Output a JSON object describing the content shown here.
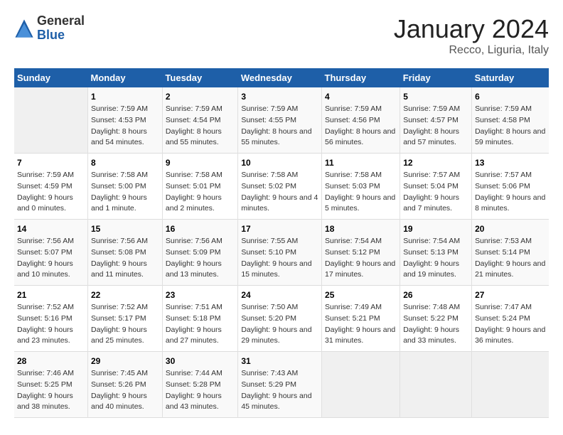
{
  "logo": {
    "general": "General",
    "blue": "Blue"
  },
  "title": "January 2024",
  "subtitle": "Recco, Liguria, Italy",
  "days_header": [
    "Sunday",
    "Monday",
    "Tuesday",
    "Wednesday",
    "Thursday",
    "Friday",
    "Saturday"
  ],
  "weeks": [
    [
      {
        "day": "",
        "sunrise": "",
        "sunset": "",
        "daylight": "",
        "empty": true
      },
      {
        "day": "1",
        "sunrise": "Sunrise: 7:59 AM",
        "sunset": "Sunset: 4:53 PM",
        "daylight": "Daylight: 8 hours and 54 minutes.",
        "empty": false
      },
      {
        "day": "2",
        "sunrise": "Sunrise: 7:59 AM",
        "sunset": "Sunset: 4:54 PM",
        "daylight": "Daylight: 8 hours and 55 minutes.",
        "empty": false
      },
      {
        "day": "3",
        "sunrise": "Sunrise: 7:59 AM",
        "sunset": "Sunset: 4:55 PM",
        "daylight": "Daylight: 8 hours and 55 minutes.",
        "empty": false
      },
      {
        "day": "4",
        "sunrise": "Sunrise: 7:59 AM",
        "sunset": "Sunset: 4:56 PM",
        "daylight": "Daylight: 8 hours and 56 minutes.",
        "empty": false
      },
      {
        "day": "5",
        "sunrise": "Sunrise: 7:59 AM",
        "sunset": "Sunset: 4:57 PM",
        "daylight": "Daylight: 8 hours and 57 minutes.",
        "empty": false
      },
      {
        "day": "6",
        "sunrise": "Sunrise: 7:59 AM",
        "sunset": "Sunset: 4:58 PM",
        "daylight": "Daylight: 8 hours and 59 minutes.",
        "empty": false
      }
    ],
    [
      {
        "day": "7",
        "sunrise": "Sunrise: 7:59 AM",
        "sunset": "Sunset: 4:59 PM",
        "daylight": "Daylight: 9 hours and 0 minutes.",
        "empty": false
      },
      {
        "day": "8",
        "sunrise": "Sunrise: 7:58 AM",
        "sunset": "Sunset: 5:00 PM",
        "daylight": "Daylight: 9 hours and 1 minute.",
        "empty": false
      },
      {
        "day": "9",
        "sunrise": "Sunrise: 7:58 AM",
        "sunset": "Sunset: 5:01 PM",
        "daylight": "Daylight: 9 hours and 2 minutes.",
        "empty": false
      },
      {
        "day": "10",
        "sunrise": "Sunrise: 7:58 AM",
        "sunset": "Sunset: 5:02 PM",
        "daylight": "Daylight: 9 hours and 4 minutes.",
        "empty": false
      },
      {
        "day": "11",
        "sunrise": "Sunrise: 7:58 AM",
        "sunset": "Sunset: 5:03 PM",
        "daylight": "Daylight: 9 hours and 5 minutes.",
        "empty": false
      },
      {
        "day": "12",
        "sunrise": "Sunrise: 7:57 AM",
        "sunset": "Sunset: 5:04 PM",
        "daylight": "Daylight: 9 hours and 7 minutes.",
        "empty": false
      },
      {
        "day": "13",
        "sunrise": "Sunrise: 7:57 AM",
        "sunset": "Sunset: 5:06 PM",
        "daylight": "Daylight: 9 hours and 8 minutes.",
        "empty": false
      }
    ],
    [
      {
        "day": "14",
        "sunrise": "Sunrise: 7:56 AM",
        "sunset": "Sunset: 5:07 PM",
        "daylight": "Daylight: 9 hours and 10 minutes.",
        "empty": false
      },
      {
        "day": "15",
        "sunrise": "Sunrise: 7:56 AM",
        "sunset": "Sunset: 5:08 PM",
        "daylight": "Daylight: 9 hours and 11 minutes.",
        "empty": false
      },
      {
        "day": "16",
        "sunrise": "Sunrise: 7:56 AM",
        "sunset": "Sunset: 5:09 PM",
        "daylight": "Daylight: 9 hours and 13 minutes.",
        "empty": false
      },
      {
        "day": "17",
        "sunrise": "Sunrise: 7:55 AM",
        "sunset": "Sunset: 5:10 PM",
        "daylight": "Daylight: 9 hours and 15 minutes.",
        "empty": false
      },
      {
        "day": "18",
        "sunrise": "Sunrise: 7:54 AM",
        "sunset": "Sunset: 5:12 PM",
        "daylight": "Daylight: 9 hours and 17 minutes.",
        "empty": false
      },
      {
        "day": "19",
        "sunrise": "Sunrise: 7:54 AM",
        "sunset": "Sunset: 5:13 PM",
        "daylight": "Daylight: 9 hours and 19 minutes.",
        "empty": false
      },
      {
        "day": "20",
        "sunrise": "Sunrise: 7:53 AM",
        "sunset": "Sunset: 5:14 PM",
        "daylight": "Daylight: 9 hours and 21 minutes.",
        "empty": false
      }
    ],
    [
      {
        "day": "21",
        "sunrise": "Sunrise: 7:52 AM",
        "sunset": "Sunset: 5:16 PM",
        "daylight": "Daylight: 9 hours and 23 minutes.",
        "empty": false
      },
      {
        "day": "22",
        "sunrise": "Sunrise: 7:52 AM",
        "sunset": "Sunset: 5:17 PM",
        "daylight": "Daylight: 9 hours and 25 minutes.",
        "empty": false
      },
      {
        "day": "23",
        "sunrise": "Sunrise: 7:51 AM",
        "sunset": "Sunset: 5:18 PM",
        "daylight": "Daylight: 9 hours and 27 minutes.",
        "empty": false
      },
      {
        "day": "24",
        "sunrise": "Sunrise: 7:50 AM",
        "sunset": "Sunset: 5:20 PM",
        "daylight": "Daylight: 9 hours and 29 minutes.",
        "empty": false
      },
      {
        "day": "25",
        "sunrise": "Sunrise: 7:49 AM",
        "sunset": "Sunset: 5:21 PM",
        "daylight": "Daylight: 9 hours and 31 minutes.",
        "empty": false
      },
      {
        "day": "26",
        "sunrise": "Sunrise: 7:48 AM",
        "sunset": "Sunset: 5:22 PM",
        "daylight": "Daylight: 9 hours and 33 minutes.",
        "empty": false
      },
      {
        "day": "27",
        "sunrise": "Sunrise: 7:47 AM",
        "sunset": "Sunset: 5:24 PM",
        "daylight": "Daylight: 9 hours and 36 minutes.",
        "empty": false
      }
    ],
    [
      {
        "day": "28",
        "sunrise": "Sunrise: 7:46 AM",
        "sunset": "Sunset: 5:25 PM",
        "daylight": "Daylight: 9 hours and 38 minutes.",
        "empty": false
      },
      {
        "day": "29",
        "sunrise": "Sunrise: 7:45 AM",
        "sunset": "Sunset: 5:26 PM",
        "daylight": "Daylight: 9 hours and 40 minutes.",
        "empty": false
      },
      {
        "day": "30",
        "sunrise": "Sunrise: 7:44 AM",
        "sunset": "Sunset: 5:28 PM",
        "daylight": "Daylight: 9 hours and 43 minutes.",
        "empty": false
      },
      {
        "day": "31",
        "sunrise": "Sunrise: 7:43 AM",
        "sunset": "Sunset: 5:29 PM",
        "daylight": "Daylight: 9 hours and 45 minutes.",
        "empty": false
      },
      {
        "day": "",
        "sunrise": "",
        "sunset": "",
        "daylight": "",
        "empty": true
      },
      {
        "day": "",
        "sunrise": "",
        "sunset": "",
        "daylight": "",
        "empty": true
      },
      {
        "day": "",
        "sunrise": "",
        "sunset": "",
        "daylight": "",
        "empty": true
      }
    ]
  ]
}
